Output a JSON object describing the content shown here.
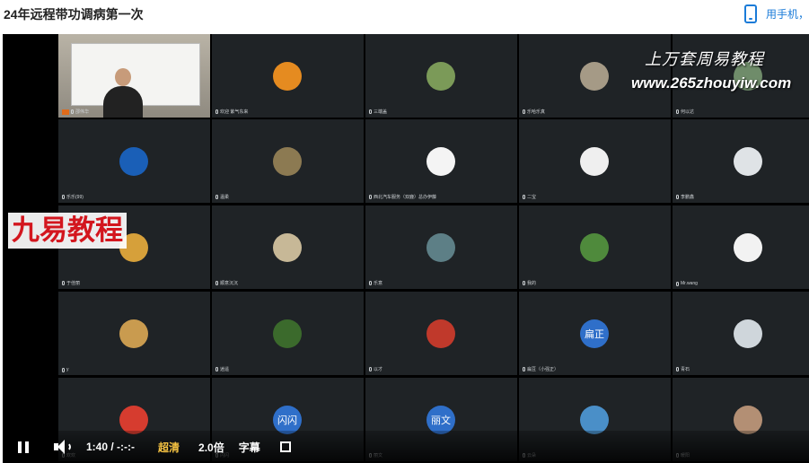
{
  "page": {
    "title": "24年远程带功调病第一次"
  },
  "header": {
    "phone_label": "用手机，"
  },
  "watermarks": {
    "line1": "上万套周易教程",
    "line2": "www.265zhouyiw.com",
    "brand": "九易教程"
  },
  "host": {
    "name": "邵伟华"
  },
  "participants": [
    {
      "name": "欢迎 紫气东来",
      "avatar": "#e58b20"
    },
    {
      "name": "三端盖",
      "avatar": "#7b9a58"
    },
    {
      "name": "乐哈乐真",
      "avatar": "#a59a86"
    },
    {
      "name": "何以达",
      "avatar": "#6f8c6a"
    },
    {
      "name": "乐乐(99)",
      "avatar": "#1a5fb7"
    },
    {
      "name": "温柔",
      "avatar": "#8c7a52"
    },
    {
      "name": "西北汽车服务（双鹿）总办伊藤",
      "avatar": "#f4f4f4"
    },
    {
      "name": "二宝",
      "avatar": "#efefef"
    },
    {
      "name": "李鹏鑫",
      "avatar": "#dfe3e6"
    },
    {
      "name": "于佳丽",
      "avatar": "#d6a03a"
    },
    {
      "name": "顺意沉沉",
      "avatar": "#c7b897"
    },
    {
      "name": "乐意",
      "avatar": "#5d7f86"
    },
    {
      "name": "我的",
      "avatar": "#4f8a3c"
    },
    {
      "name": "Mr.wang",
      "avatar": "#f2f2f2"
    },
    {
      "name": "y",
      "avatar": "#c99b4f"
    },
    {
      "name": "逍遥",
      "avatar": "#3b6a2c"
    },
    {
      "name": "以才",
      "avatar": "#c0392b"
    },
    {
      "name": "扁豆（小强正）",
      "avatar": "#2f6fc9",
      "label": "扁正"
    },
    {
      "name": "青石",
      "avatar": "#cfd6db"
    },
    {
      "name": "欢欢",
      "avatar": "#d63c2f"
    },
    {
      "name": "闪闪",
      "avatar": "#2f6fc9",
      "label": "闪闪"
    },
    {
      "name": "丽文",
      "avatar": "#2f6fc9",
      "label": "丽文"
    },
    {
      "name": "云朵",
      "avatar": "#4a8fc8"
    },
    {
      "name": "暖阳",
      "avatar": "#b38f74"
    }
  ],
  "player": {
    "time": "1:40 / -:-:-",
    "quality": "超清",
    "speed": "2.0倍",
    "subtitles": "字幕"
  },
  "colors": {
    "accent": "#1a7bd8",
    "quality": "#f5c242",
    "brand_red": "#d3161e"
  }
}
